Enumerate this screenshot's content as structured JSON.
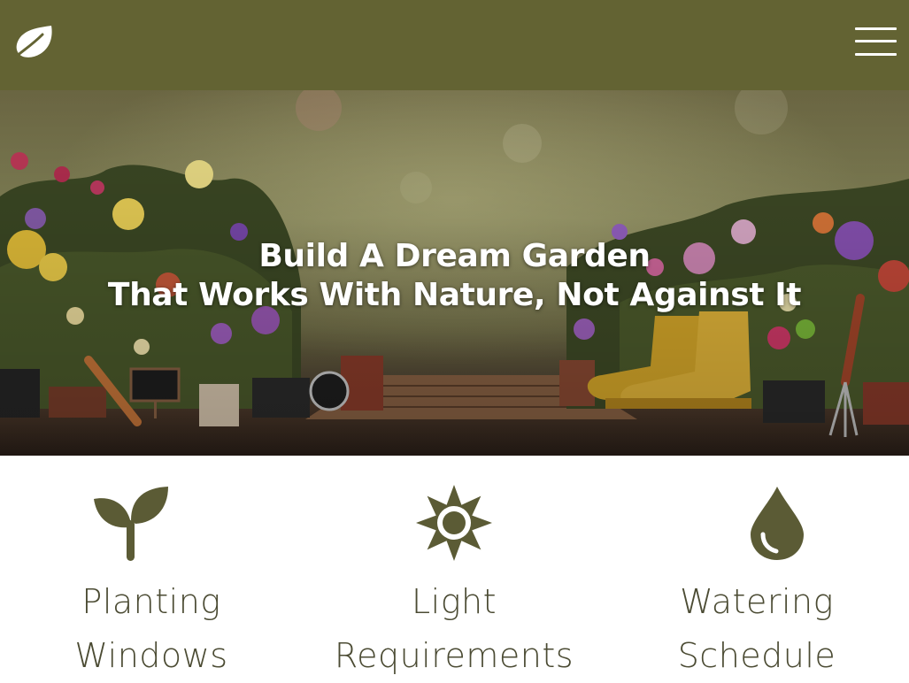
{
  "header": {
    "logo_icon": "leaf-icon",
    "menu_icon": "hamburger-menu-icon",
    "background_color": "#636333"
  },
  "hero": {
    "title_line1": "Build A Dream Garden",
    "title_line2": "That Works With Nature, Not Against It"
  },
  "features": [
    {
      "icon": "sprout-icon",
      "line1": "Planting",
      "line2": "Windows"
    },
    {
      "icon": "sun-icon",
      "line1": "Light",
      "line2": "Requirements"
    },
    {
      "icon": "water-drop-icon",
      "line1": "Watering",
      "line2": "Schedule"
    }
  ],
  "colors": {
    "brand": "#636333",
    "icon": "#5b5b35",
    "text": "#4b4b33"
  }
}
